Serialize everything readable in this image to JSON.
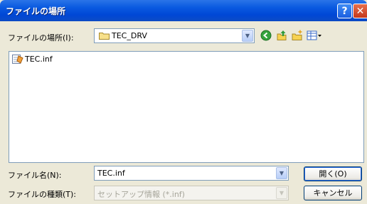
{
  "window": {
    "title": "ファイルの場所"
  },
  "titlebar_buttons": {
    "help": "?",
    "close": "✕"
  },
  "lookin": {
    "label": "ファイルの場所(I):",
    "value": "TEC_DRV"
  },
  "files": [
    {
      "name": "TEC.inf",
      "icon": "setup-info-file-icon"
    }
  ],
  "filename": {
    "label": "ファイル名(N):",
    "value": "TEC.inf"
  },
  "filetype": {
    "label": "ファイルの種類(T):",
    "value": "セットアップ情報 (*.inf)"
  },
  "buttons": {
    "open": "開く(O)",
    "cancel": "キャンセル"
  },
  "colors": {
    "titlebar": "#0a5ae0",
    "dialog_bg": "#ece9d8",
    "field_border": "#7f9db9"
  }
}
